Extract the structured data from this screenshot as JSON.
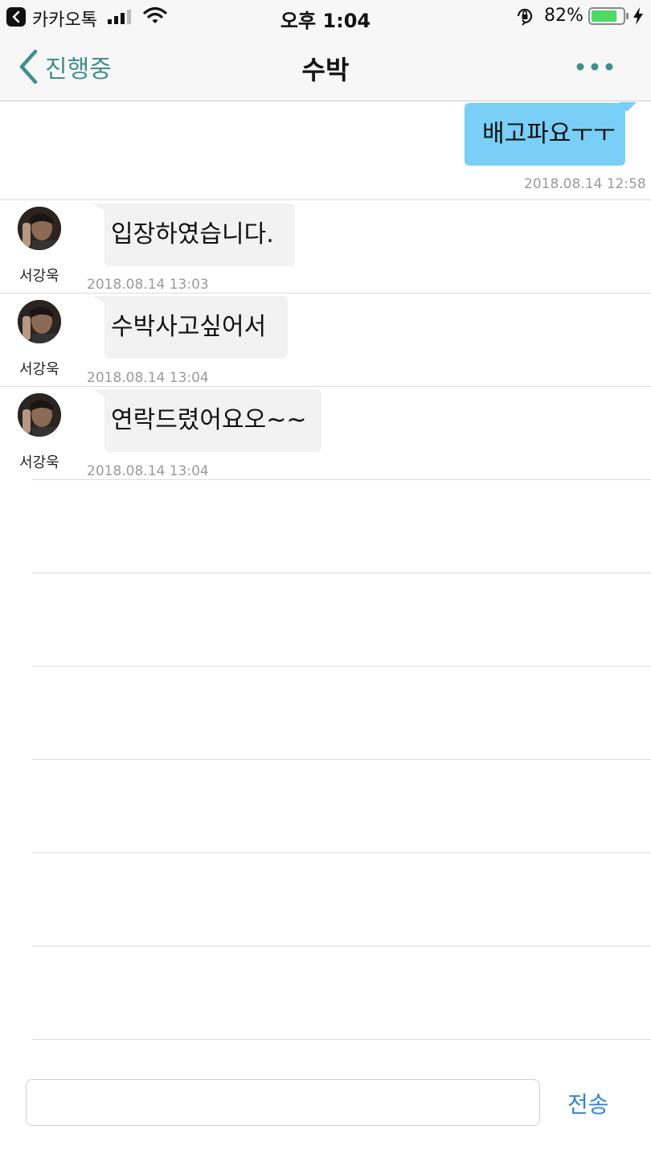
{
  "status_bar": {
    "back_app": "카카오톡",
    "time": "오후 1:04",
    "battery_percent": "82%",
    "battery_level": 0.82,
    "icons": [
      "back-app-icon",
      "signal-icon",
      "wifi-icon",
      "rotation-lock-icon",
      "battery-icon",
      "charging-icon"
    ]
  },
  "nav": {
    "back_label": "진행중",
    "title": "수박",
    "more_icon": "more-dots-icon",
    "accent_color": "#3f8f8c"
  },
  "messages": [
    {
      "direction": "out",
      "text": "배고파요ㅜㅜ",
      "timestamp": "2018.08.14 12:58",
      "bubble_color": "#79cff5"
    },
    {
      "direction": "in",
      "sender": "서강욱",
      "text": "입장하였습니다.",
      "timestamp": "2018.08.14 13:03",
      "bubble_color": "#f2f2f2"
    },
    {
      "direction": "in",
      "sender": "서강욱",
      "text": "수박사고싶어서",
      "timestamp": "2018.08.14 13:04",
      "bubble_color": "#f2f2f2"
    },
    {
      "direction": "in",
      "sender": "서강욱",
      "text": "연락드렸어요오~~",
      "timestamp": "2018.08.14 13:04",
      "bubble_color": "#f2f2f2"
    }
  ],
  "composer": {
    "value": "",
    "send_label": "전송",
    "send_color": "#2f86d6"
  }
}
